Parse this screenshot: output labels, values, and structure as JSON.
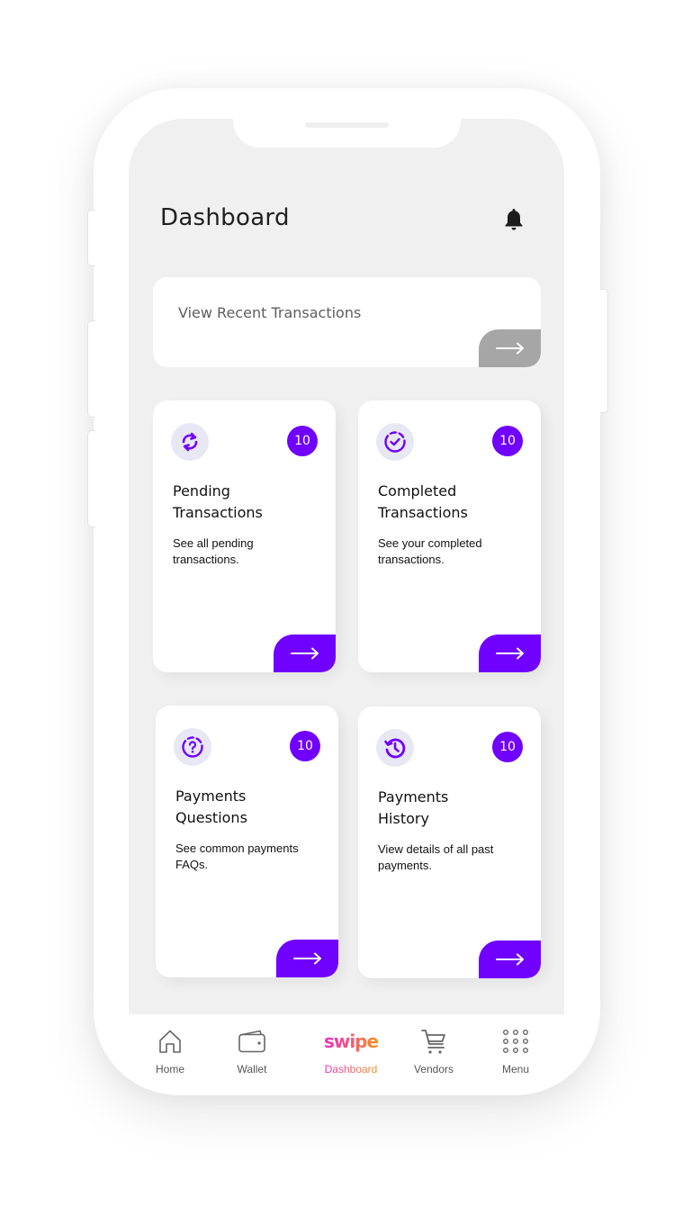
{
  "header": {
    "title": "Dashboard",
    "notification_icon": "bell-icon"
  },
  "recent": {
    "label": "View Recent Transactions",
    "arrow_icon": "arrow-right-icon"
  },
  "colors": {
    "accent": "#7000ff",
    "icon_bg": "#e8e8f4",
    "screen_bg": "#f0f0f0",
    "recent_button": "#a6a6a6",
    "brand_gradient_start": "#e72fc0",
    "brand_gradient_end": "#f7931e"
  },
  "cards": [
    {
      "title": "Pending Transactions",
      "title_line1": "Pending",
      "title_line2": "Transactions",
      "description": "See all pending transactions.",
      "count": "10",
      "icon": "refresh-icon"
    },
    {
      "title": "Completed Transactions",
      "title_line1": "Completed",
      "title_line2": "Transactions",
      "description": "See your completed transactions.",
      "count": "10",
      "icon": "check-circle-icon"
    },
    {
      "title": "Payments Questions",
      "title_line1": "Payments",
      "title_line2": "Questions",
      "description": "See common payments FAQs.",
      "count": "10",
      "icon": "question-circle-icon"
    },
    {
      "title": "Payments History",
      "title_line1": "Payments",
      "title_line2": "History",
      "description": "View details of all past payments.",
      "count": "10",
      "icon": "history-icon"
    }
  ],
  "nav": {
    "items": [
      {
        "label": "Home",
        "icon": "home-icon",
        "active": false
      },
      {
        "label": "Wallet",
        "icon": "wallet-icon",
        "active": false
      },
      {
        "label": "Dashboard",
        "icon": "swipe-logo",
        "active": true
      },
      {
        "label": "Vendors",
        "icon": "cart-icon",
        "active": false
      },
      {
        "label": "Menu",
        "icon": "grid-icon",
        "active": false
      }
    ],
    "logo_text": "swipe"
  }
}
